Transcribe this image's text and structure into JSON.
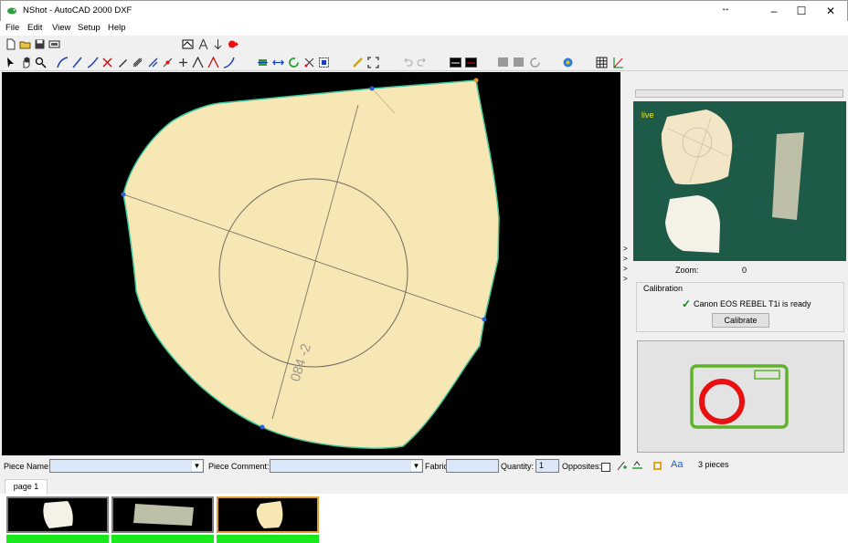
{
  "window": {
    "title": "NShot - AutoCAD 2000 DXF",
    "minimize_glyph": "–",
    "maximize_glyph": "☐",
    "close_glyph": "✕",
    "resize_glyph": "↔"
  },
  "menu": {
    "items": [
      "File",
      "Edit",
      "View",
      "Setup",
      "Help"
    ]
  },
  "toolbar1": {
    "icons": [
      "new-file-icon",
      "open-folder-icon",
      "save-icon",
      "print-icon",
      "scan-icon",
      "measure-icon",
      "arrow-down-icon",
      "record-icon"
    ],
    "input_value": ""
  },
  "toolbar2": {
    "icons": [
      "select-arrow-icon",
      "pan-hand-icon",
      "zoom-icon",
      "curve-icon",
      "line-icon",
      "delete-point-icon",
      "pencil-icon",
      "tool-icon",
      "tool-icon",
      "point-icon",
      "notch-icon",
      "edit-icon",
      "spline-icon",
      "move-icon",
      "flip-icon",
      "rotate-icon",
      "cut-icon",
      "select-box-icon",
      "ruler-icon",
      "fit-icon",
      "undo-icon",
      "redo-icon",
      "view-mode-icon",
      "view-mode-icon",
      "gray-square-icon",
      "gray-square-icon",
      "refresh-icon",
      "info-icon",
      "grid-icon",
      "axis-icon"
    ]
  },
  "right_panel": {
    "live_label": "live",
    "zoom_label": "Zoom:",
    "zoom_value": "0",
    "calibration_title": "Calibration",
    "camera_status": "Canon EOS REBEL T1i  is ready",
    "calibrate_button": "Calibrate"
  },
  "fields": {
    "piece_name_label": "Piece Name:",
    "piece_name_value": "",
    "piece_comment_label": "Piece Comment:",
    "piece_comment_value": "",
    "fabric_label": "Fabric",
    "fabric_value": "",
    "quantity_label": "Quantity:",
    "quantity_value": "1",
    "opposites_label": "Opposites:",
    "font_button": "Aa",
    "pieces_count": "3 pieces"
  },
  "tabs": [
    "page 1"
  ],
  "thumbnails": [
    {
      "name": "piece-1",
      "selected": false
    },
    {
      "name": "piece-2",
      "selected": false
    },
    {
      "name": "piece-3",
      "selected": true
    }
  ],
  "canvas": {
    "piece_text": "084 -2"
  },
  "colors": {
    "piece_fill": "#f7e7b4",
    "piece_outline": "#3ec79a",
    "live_bg": "#1d5a48",
    "thumb_status": "#18e81c",
    "camera_red": "#e81010",
    "camera_green": "#5fb32a"
  }
}
